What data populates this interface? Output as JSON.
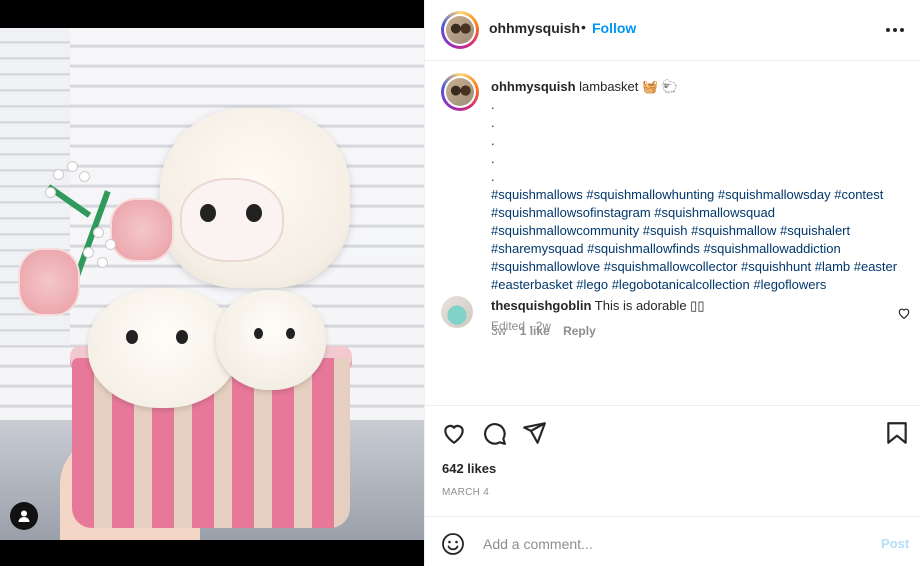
{
  "post": {
    "username": "ohhmysquish",
    "separator": "•",
    "follow_label": "Follow",
    "more_icon": "more-horizontal-icon"
  },
  "caption": {
    "username": "ohhmysquish",
    "title": "lambasket 🧺 🐑",
    "dots": [
      ".",
      ".",
      ".",
      ".",
      "."
    ],
    "hashtags": "#squishmallows #squishmallowhunting #squishmallowsday #contest #squishmallowsofinstagram #squishmallowsquad #squishmallowcommunity #squish #squishmallow #squishalert #sharemysquad #squishmallowfinds #squishmallowaddiction #squishmallowlove #squishmallowcollector #squishhunt #lamb #easter #easterbasket #lego #legobotanicalcollection #legoflowers",
    "edited": "Edited · 2w"
  },
  "comment": {
    "username": "thesquishgoblin",
    "text": "This is adorable ▯▯",
    "time": "3w",
    "likes": "1 like",
    "reply": "Reply"
  },
  "stats": {
    "likes": "642 likes",
    "date": "MARCH 4"
  },
  "composer": {
    "placeholder": "Add a comment...",
    "post_label": "Post"
  },
  "colors": {
    "follow": "#0095f6",
    "hashtag": "#00376b",
    "post_disabled": "#b2dffc"
  }
}
